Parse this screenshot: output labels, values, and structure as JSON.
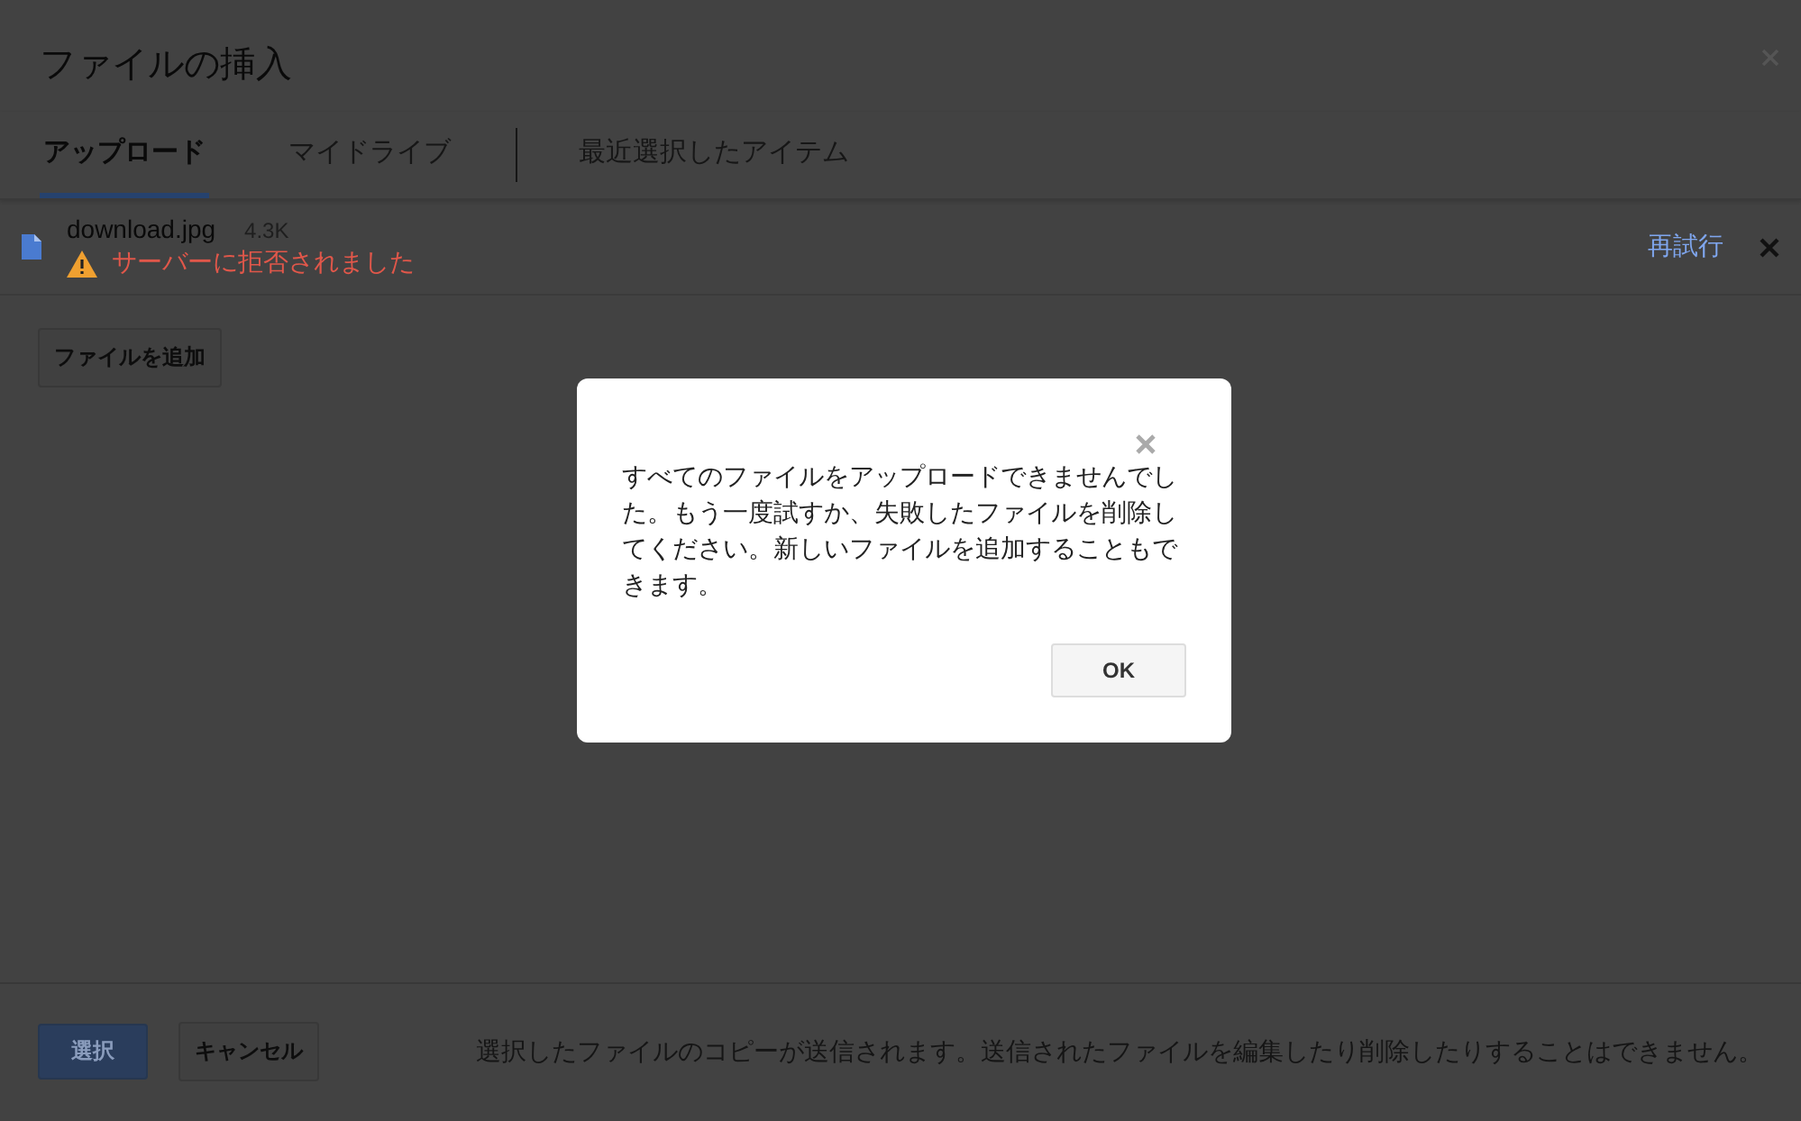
{
  "window": {
    "title": "ファイルの挿入"
  },
  "tabs": [
    {
      "label": "アップロード",
      "selected": true
    },
    {
      "label": "マイドライブ",
      "selected": false
    },
    {
      "label": "最近選択したアイテム",
      "selected": false
    }
  ],
  "files": [
    {
      "name": "download.jpg",
      "size": "4.3K",
      "error": "サーバーに拒否されました",
      "retry": "再試行"
    }
  ],
  "add_button": "ファイルを追加",
  "footer": {
    "select_button": {
      "label": "選択",
      "disabled": true
    },
    "cancel_button": "キャンセル",
    "note": "選択したファイルのコピーが送信されます。送信されたファイルを編集したり削除したりすることはできません。"
  },
  "alert": {
    "message": "すべてのファイルをアップロードできませんでした。もう一度試すか、失敗したファイルを削除してください。新しいファイルを追加することもできます。",
    "ok_button": "OK"
  }
}
